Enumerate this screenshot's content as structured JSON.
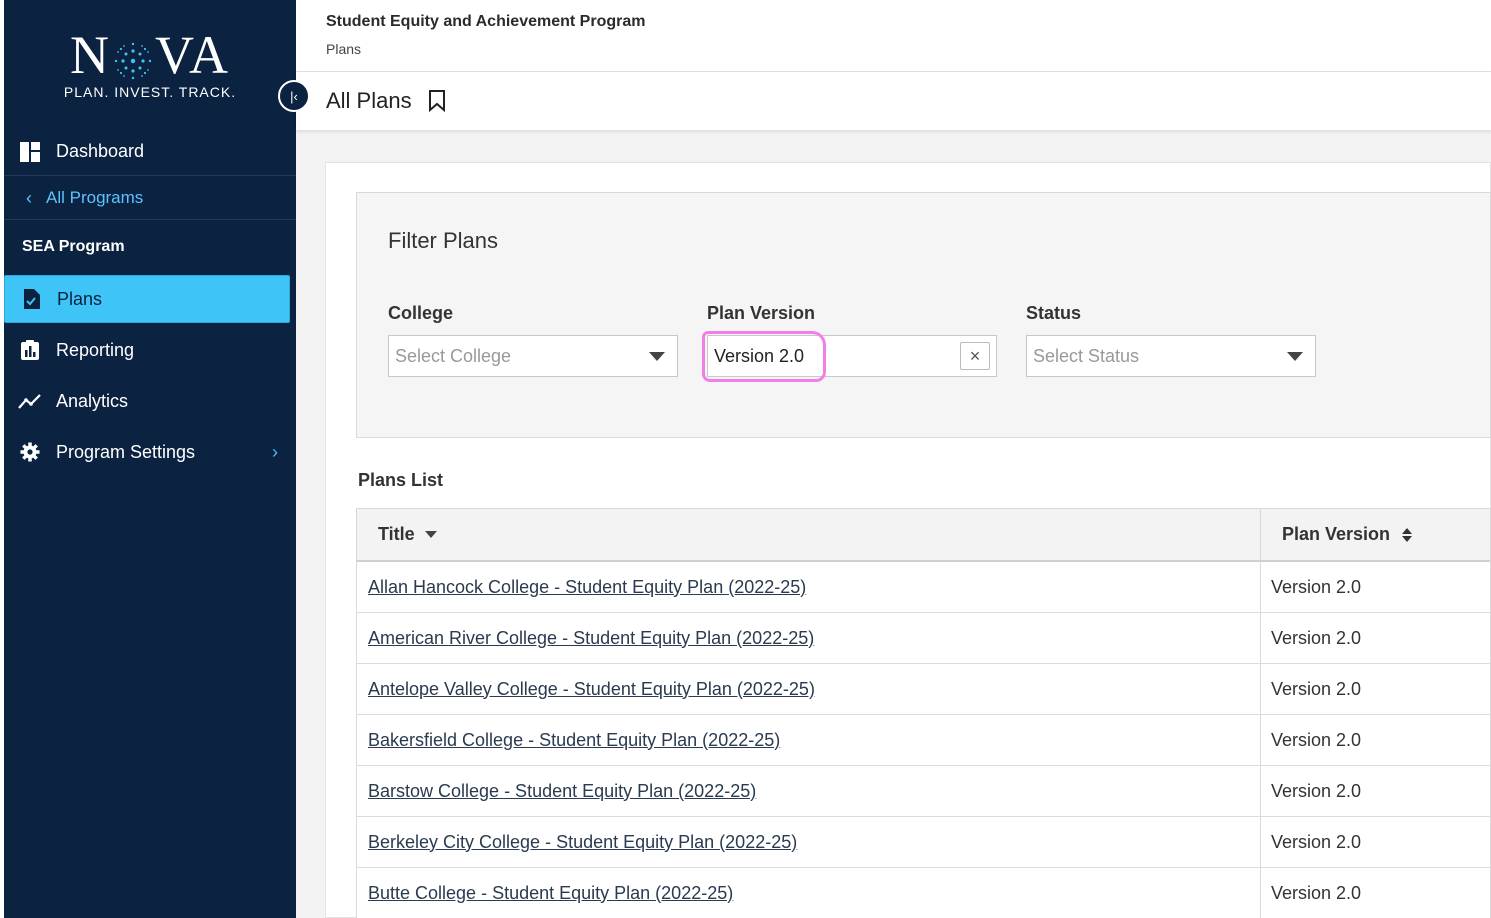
{
  "brand": {
    "logo_text": "NOVA",
    "tagline": "PLAN. INVEST. TRACK."
  },
  "sidebar": {
    "dashboard": "Dashboard",
    "all_programs": "All Programs",
    "section": "SEA Program",
    "items": [
      {
        "label": "Plans",
        "icon": "document-check-icon",
        "active": true
      },
      {
        "label": "Reporting",
        "icon": "chart-clipboard-icon"
      },
      {
        "label": "Analytics",
        "icon": "trend-line-icon"
      },
      {
        "label": "Program Settings",
        "icon": "gear-icon"
      }
    ]
  },
  "header": {
    "program": "Student Equity and Achievement Program",
    "breadcrumb": "Plans"
  },
  "page": {
    "title": "All Plans"
  },
  "filter": {
    "title": "Filter Plans",
    "college": {
      "label": "College",
      "placeholder": "Select College"
    },
    "plan_version": {
      "label": "Plan Version",
      "value": "Version 2.0"
    },
    "status": {
      "label": "Status",
      "placeholder": "Select Status"
    }
  },
  "plans_list": {
    "title": "Plans List",
    "columns": [
      "Title",
      "Plan Version"
    ],
    "rows": [
      {
        "title": "Allan Hancock College - Student Equity Plan (2022-25)",
        "version": "Version 2.0"
      },
      {
        "title": "American River College - Student Equity Plan (2022-25)",
        "version": "Version 2.0"
      },
      {
        "title": "Antelope Valley College - Student Equity Plan (2022-25)",
        "version": "Version 2.0"
      },
      {
        "title": "Bakersfield College - Student Equity Plan (2022-25)",
        "version": "Version 2.0"
      },
      {
        "title": "Barstow College - Student Equity Plan (2022-25)",
        "version": "Version 2.0"
      },
      {
        "title": "Berkeley City College - Student Equity Plan (2022-25)",
        "version": "Version 2.0"
      },
      {
        "title": "Butte College - Student Equity Plan (2022-25)",
        "version": "Version 2.0"
      }
    ]
  },
  "colors": {
    "sidebar_bg": "#0b2240",
    "accent": "#3fc4f7",
    "highlight": "#f37ee8"
  }
}
